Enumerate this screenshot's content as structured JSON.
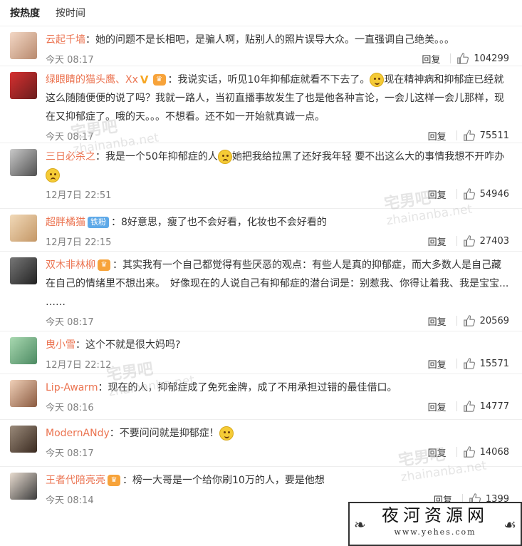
{
  "tabs": [
    {
      "label": "按热度"
    },
    {
      "label": "按时间"
    }
  ],
  "reply_label": "回复",
  "comments": [
    {
      "user": "云起千墙",
      "segments": [
        "：她的问题不是长相吧，是骗人啊，贴别人的照片误导大众。一直强调自己绝美。。。"
      ],
      "time": "今天 08:17",
      "likes": "104299"
    },
    {
      "user": "绿眼睛的猫头鹰、Xx",
      "segments": [
        "：我说实话，听见10年抑郁症就看不下去了。",
        "现在精神病和抑郁症已经就这么随随便便的说了吗？我就一路人，当初直播事故发生了也是他各种言论，一会儿这样一会儿那样，现在又抑郁症了。哦的天。。。不想看。还不如一开始就真诚一点。"
      ],
      "time": "今天 08:17",
      "likes": "75511"
    },
    {
      "user": "三日必杀之",
      "segments": [
        "：我是一个50年抑郁症的人",
        "她把我给拉黑了还好我年轻 要不出这么大的事情我想不开咋办",
        ""
      ],
      "time": "12月7日 22:51",
      "likes": "54946"
    },
    {
      "user": "超胖橘猫",
      "badge_text": "铁粉",
      "segments": [
        "：8好意思，瘦了也不会好看，化妆也不会好看的"
      ],
      "time": "12月7日 22:15",
      "likes": "27403"
    },
    {
      "user": "双木非林柳",
      "segments": [
        "：其实我有一个自己都觉得有些厌恶的观点：有些人是真的抑郁症，而大多数人是自己藏在自己的情绪里不想出来。　好像现在的人说自己有抑郁症的潜台词是：别惹我、你得让着我、我是宝宝... ……"
      ],
      "time": "今天 08:17",
      "likes": "20569"
    },
    {
      "user": "曳小雪",
      "segments": [
        "：这个不就是很大妈吗?"
      ],
      "time": "12月7日 22:12",
      "likes": "15571"
    },
    {
      "user": "Lip-Awarm",
      "segments": [
        "：现在的人，抑郁症成了免死金牌，成了不用承担过错的最佳借口。"
      ],
      "time": "今天 08:16",
      "likes": "14777"
    },
    {
      "user": "ModernANdy",
      "segments": [
        "：不要问问就是抑郁症！"
      ],
      "time": "今天 08:17",
      "likes": "14068"
    },
    {
      "user": "王者代陪亮亮",
      "segments": [
        "：榜一大哥是一个给你刷10万的人，要是他想"
      ],
      "time": "今天 08:14",
      "likes": "1399"
    }
  ],
  "watermark": {
    "brand": "宅男吧",
    "url": "zhainanba.net"
  },
  "logo": {
    "title": "夜河资源网",
    "url": "www.yehes.com"
  },
  "colors": {
    "username": "#eb7350",
    "meta": "#808080",
    "text": "#333333",
    "vip": "#f6a623",
    "fan_badge": "#5ea9e8"
  }
}
